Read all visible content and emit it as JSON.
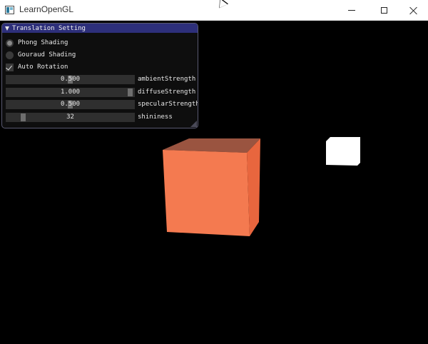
{
  "window": {
    "title": "LearnOpenGL",
    "icon": "app-icon"
  },
  "panel": {
    "title": "Translation Setting",
    "shading_options": [
      {
        "label": "Phong Shading",
        "selected": true
      },
      {
        "label": "Gouraud Shading",
        "selected": false
      }
    ],
    "auto_rotation": {
      "label": "Auto Rotation",
      "checked": true
    },
    "sliders": [
      {
        "label": "ambientStrength",
        "value_text": "0.500",
        "value": 0.5
      },
      {
        "label": "diffuseStrength",
        "value_text": "1.000",
        "value": 1.0
      },
      {
        "label": "specularStrength",
        "value_text": "0.500",
        "value": 0.5
      },
      {
        "label": "shininess",
        "value_text": "32",
        "value": 32
      }
    ]
  },
  "colors": {
    "panel_header": "#2d2f7a",
    "cube_front": "#f47a50",
    "cube_top": "#9a5440",
    "cube_side": "#e8663e",
    "light_cube": "#ffffff"
  }
}
